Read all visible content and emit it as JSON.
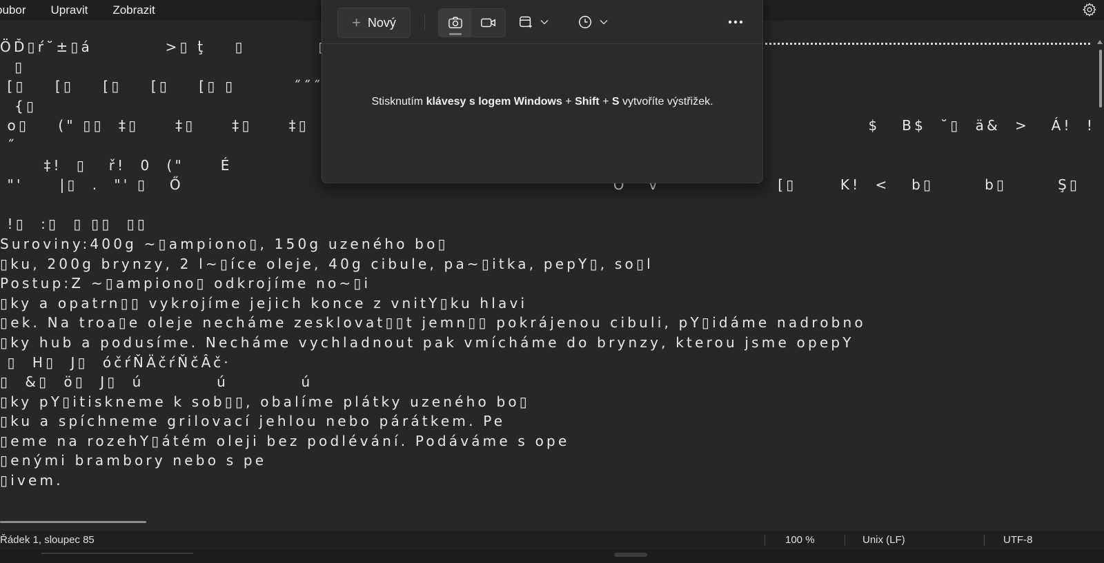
{
  "menu": {
    "items": [
      {
        "label": "oubor"
      },
      {
        "label": "Upravit"
      },
      {
        "label": "Zobrazit"
      }
    ],
    "settings_icon": "gear-icon"
  },
  "editor": {
    "lines": [
      "ÖĎ▯ŕ˘±▯á          >▯ ţ̇    ▯          ▯  8",
      "  ▯",
      " [▯    [▯    [▯    [▯    [▯ ▯        ˝˝˝   o",
      "  {▯",
      " o▯    (\" ▯▯  ‡▯     ‡▯     ‡▯     ‡▯     ‡▯                                                                     $   B$  ˘▯  ä&  >   Á!  !                 [▯      b▯",
      " ˝",
      "      ‡!  ▯   ř!  0  (\"     É",
      " \"'     |▯  .  \"' ▯   Ő                                                           Ö   v  \"'            [▯      K!  <   b▯       b▯       Ş▯       b▯       b▯",
      "",
      " !▯  :▯  ▯ ▯▯  ▯▯",
      "Suroviny:400g ~▯ampiono▯, 150g uzeného bo▯",
      "▯ku, 200g brynzy, 2 l~▯íce oleje, 40g cibule, pa~▯itka, pepY▯, so▯l",
      "Postup:Z ~▯ampiono▯ odkrojíme no~▯i",
      "▯ky a opatrn▯▯ vykrojíme jejich konce z vnitY▯ku hlavi",
      "▯ek. Na troa▯e oleje necháme zesklovat▯▯t jemn▯▯ pokrájenou cibuli, pY▯idáme nadrobno",
      "▯ky hub a podusíme. Necháme vychladnout pak vmícháme do brynzy, kterou jsme opepY",
      " ▯  H▯  J▯  óčŕŇÄčŕŇčÂč·",
      "▯  &▯  ö▯  J▯  ú          ú          ú",
      "▯ky pY▯itiskneme k sob▯▯, obalíme plátky uzeného bo▯",
      "▯ku a spíchneme grilovací jehlou nebo párátkem. Pe",
      "▯eme na rozehY▯átém oleji bez podlévání. Podáváme s ope",
      "▯enými brambory nebo s pe",
      "▯ivem."
    ]
  },
  "status": {
    "position": "Řádek 1, sloupec 85",
    "zoom": "100 %",
    "line_ending": "Unix (LF)",
    "encoding": "UTF-8"
  },
  "snipping_tool": {
    "new_button_label": "Nový",
    "new_icon": "plus-icon",
    "screenshot_mode_icon": "camera-icon",
    "video_mode_icon": "video-camera-icon",
    "shape_icon": "rectangle-snip-icon",
    "delay_icon": "clock-icon",
    "more_icon": "more-horizontal-icon",
    "hint_prefix": "Stisknutím ",
    "hint_bold_1": "klávesy s logem Windows",
    "hint_plus_1": " + ",
    "hint_bold_2": "Shift",
    "hint_plus_2": " + ",
    "hint_bold_3": "S",
    "hint_suffix": " vytvoříte výstřižek."
  }
}
